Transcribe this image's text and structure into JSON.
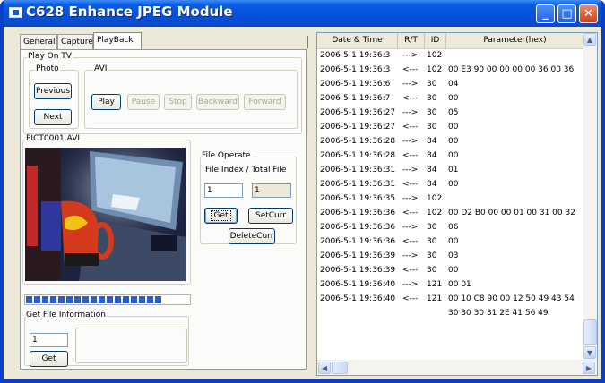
{
  "window": {
    "title": "C628 Enhance JPEG Module"
  },
  "tabs": [
    "General",
    "Capture",
    "PlayBack"
  ],
  "play_on_tv": {
    "group_label": "Play On TV",
    "photo": {
      "label": "Photo",
      "previous": "Previous",
      "next": "Next"
    },
    "avi": {
      "label": "AVI",
      "play": "Play",
      "pause": "Pause",
      "stop": "Stop",
      "backward": "Backward",
      "forward": "Forward"
    }
  },
  "preview": {
    "file_name": "PICT0001.AVI",
    "progress_percent": 86
  },
  "file_operate": {
    "label": "File Operate",
    "index_caption": "File Index  / Total File",
    "file_index": "1",
    "total_file": "1",
    "get": "Get",
    "set_curr": "SetCurr",
    "delete_curr": "DeleteCurr"
  },
  "get_file_info": {
    "label": "Get File Information",
    "input_value": "1",
    "get": "Get"
  },
  "log": {
    "columns": [
      "Date & Time",
      "R/T",
      "ID",
      "Parameter(hex)"
    ],
    "rows": [
      [
        "2006-5-1 19:36:3",
        "--->",
        "102",
        ""
      ],
      [
        "2006-5-1 19:36:3",
        "<---",
        "102",
        "00 E3 90 00 00 00 00 36 00 36"
      ],
      [
        "2006-5-1 19:36:6",
        "--->",
        "30",
        "04"
      ],
      [
        "2006-5-1 19:36:7",
        "<---",
        "30",
        "00"
      ],
      [
        "2006-5-1 19:36:27",
        "--->",
        "30",
        "05"
      ],
      [
        "2006-5-1 19:36:27",
        "<---",
        "30",
        "00"
      ],
      [
        "2006-5-1 19:36:28",
        "--->",
        "84",
        "00"
      ],
      [
        "2006-5-1 19:36:28",
        "<---",
        "84",
        "00"
      ],
      [
        "2006-5-1 19:36:31",
        "--->",
        "84",
        "01"
      ],
      [
        "2006-5-1 19:36:31",
        "<---",
        "84",
        "00"
      ],
      [
        "2006-5-1 19:36:35",
        "--->",
        "102",
        ""
      ],
      [
        "2006-5-1 19:36:36",
        "<---",
        "102",
        "00 D2 B0 00 00 01 00 31 00 32"
      ],
      [
        "2006-5-1 19:36:36",
        "--->",
        "30",
        "06"
      ],
      [
        "2006-5-1 19:36:36",
        "<---",
        "30",
        "00"
      ],
      [
        "2006-5-1 19:36:39",
        "--->",
        "30",
        "03"
      ],
      [
        "2006-5-1 19:36:39",
        "<---",
        "30",
        "00"
      ],
      [
        "2006-5-1 19:36:40",
        "--->",
        "121",
        "00 01"
      ],
      [
        "2006-5-1 19:36:40",
        "<---",
        "121",
        "00 10 C8 90 00 12 50 49 43 54"
      ],
      [
        "",
        "",
        "",
        "30 30 30 31 2E 41 56 49"
      ]
    ]
  }
}
